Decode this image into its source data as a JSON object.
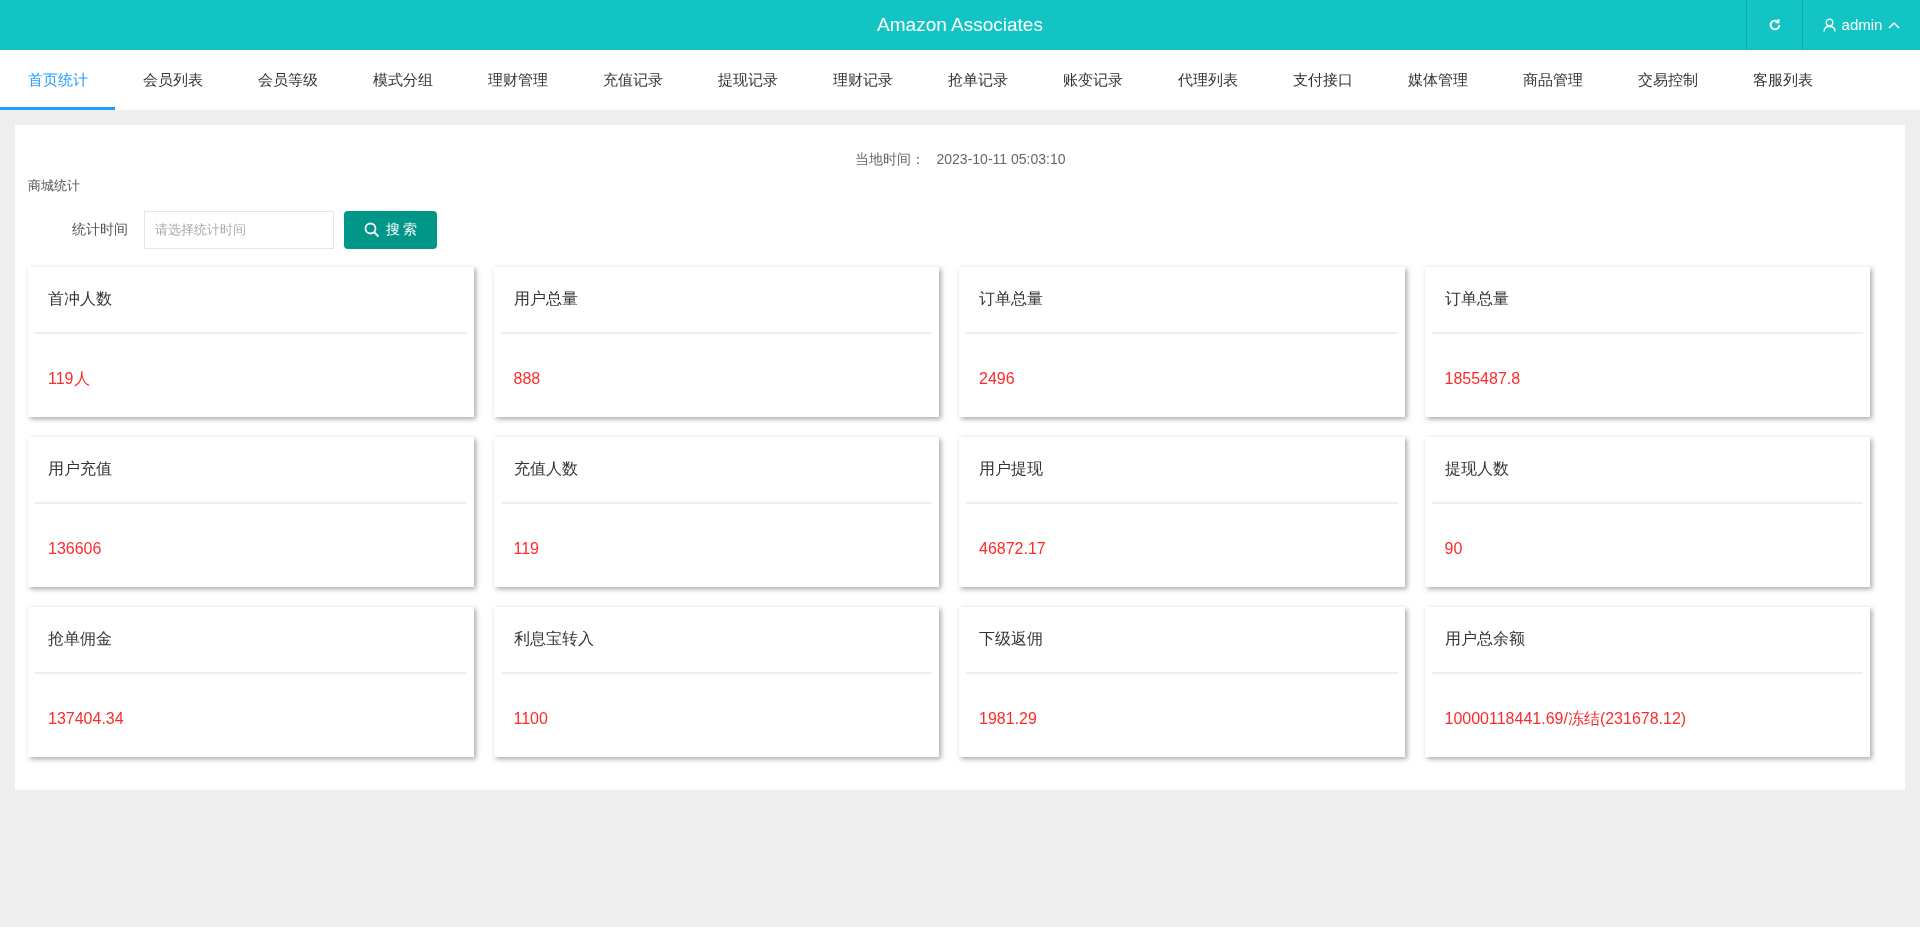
{
  "header": {
    "title": "Amazon Associates",
    "user": "admin"
  },
  "tabs": [
    {
      "label": "首页统计",
      "selected": true
    },
    {
      "label": "会员列表",
      "selected": false
    },
    {
      "label": "会员等级",
      "selected": false
    },
    {
      "label": "模式分组",
      "selected": false
    },
    {
      "label": "理财管理",
      "selected": false
    },
    {
      "label": "充值记录",
      "selected": false
    },
    {
      "label": "提现记录",
      "selected": false
    },
    {
      "label": "理财记录",
      "selected": false
    },
    {
      "label": "抢单记录",
      "selected": false
    },
    {
      "label": "账变记录",
      "selected": false
    },
    {
      "label": "代理列表",
      "selected": false
    },
    {
      "label": "支付接口",
      "selected": false
    },
    {
      "label": "媒体管理",
      "selected": false
    },
    {
      "label": "商品管理",
      "selected": false
    },
    {
      "label": "交易控制",
      "selected": false
    },
    {
      "label": "客服列表",
      "selected": false
    }
  ],
  "local_time": {
    "label": "当地时间：",
    "value": "2023-10-11 05:03:10"
  },
  "section_title": "商城统计",
  "filter": {
    "label": "统计时间",
    "placeholder": "请选择统计时间",
    "button": "搜 索"
  },
  "cards": [
    {
      "title": "首冲人数",
      "value": "119人"
    },
    {
      "title": "用户总量",
      "value": "888"
    },
    {
      "title": "订单总量",
      "value": "2496"
    },
    {
      "title": "订单总量",
      "value": "1855487.8"
    },
    {
      "title": "用户充值",
      "value": "136606"
    },
    {
      "title": "充值人数",
      "value": "119"
    },
    {
      "title": "用户提现",
      "value": "46872.17"
    },
    {
      "title": "提现人数",
      "value": "90"
    },
    {
      "title": "抢单佣金",
      "value": "137404.34"
    },
    {
      "title": "利息宝转入",
      "value": "1100"
    },
    {
      "title": "下级返佣",
      "value": "1981.29"
    },
    {
      "title": "用户总余额",
      "value": "10000118441.69/冻结(231678.12)"
    }
  ]
}
